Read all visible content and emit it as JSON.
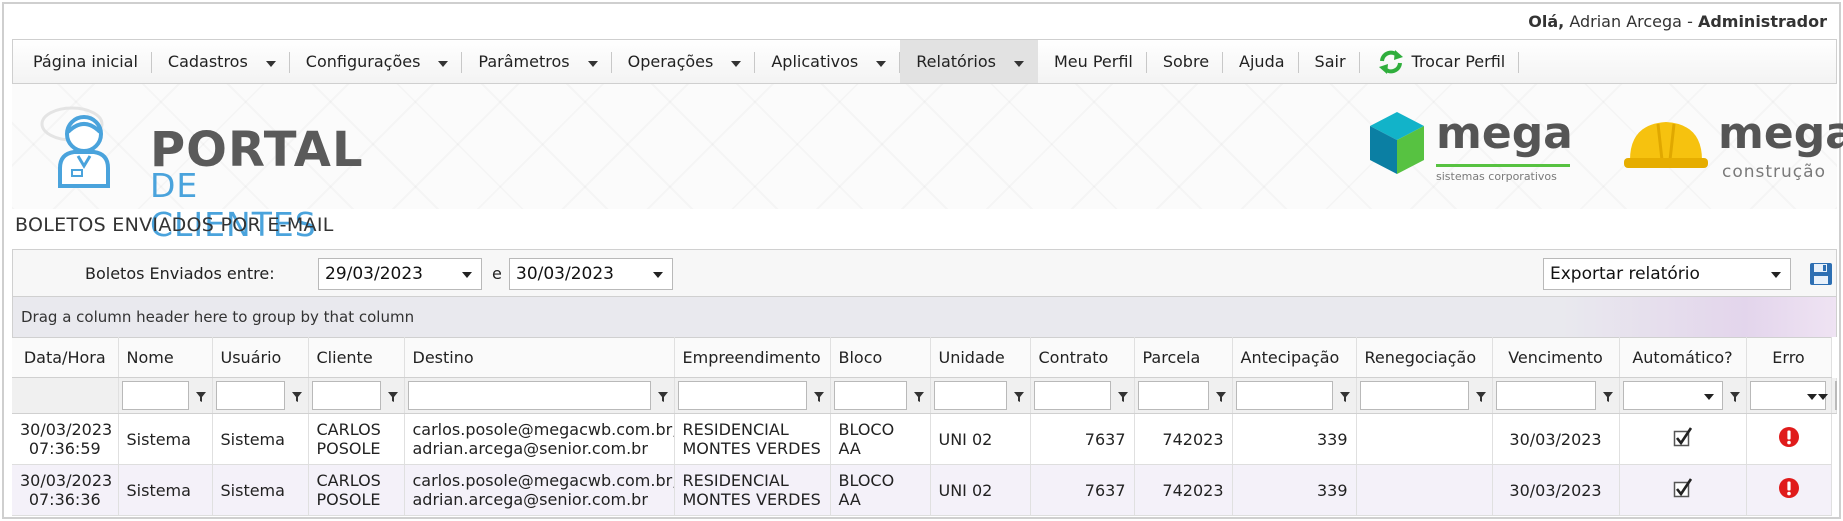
{
  "header": {
    "greeting_prefix": "Olá,",
    "user_name": "Adrian Arcega",
    "separator": "-",
    "role": "Administrador"
  },
  "menu": {
    "items": [
      {
        "label": "Página inicial",
        "dropdown": false
      },
      {
        "label": "Cadastros",
        "dropdown": true
      },
      {
        "label": "Configurações",
        "dropdown": true
      },
      {
        "label": "Parâmetros",
        "dropdown": true
      },
      {
        "label": "Operações",
        "dropdown": true
      },
      {
        "label": "Aplicativos",
        "dropdown": true
      },
      {
        "label": "Relatórios",
        "dropdown": true,
        "active": true
      },
      {
        "label": "Meu Perfil",
        "dropdown": false
      },
      {
        "label": "Sobre",
        "dropdown": false
      },
      {
        "label": "Ajuda",
        "dropdown": false
      },
      {
        "label": "Sair",
        "dropdown": false
      }
    ],
    "switch_profile": {
      "label": "Trocar Perfil",
      "icon": "refresh-icon"
    }
  },
  "banner": {
    "portal_title": "PORTAL",
    "portal_subtitle": "DE CLIENTES",
    "mega1_name": "mega",
    "mega1_sub": "sistemas corporativos",
    "mega2_name": "mega",
    "mega2_sub": "construção"
  },
  "page": {
    "title": "BOLETOS ENVIADOS POR E-MAIL"
  },
  "filters": {
    "range_label": "Boletos Enviados entre:",
    "date_from": "29/03/2023",
    "conjunction": "e",
    "date_to": "30/03/2023",
    "export_select": "Exportar relatório",
    "save_icon": "save-icon"
  },
  "grid": {
    "group_hint": "Drag a column header here to group by that column",
    "columns": {
      "datahora": "Data/Hora",
      "nome": "Nome",
      "usuario": "Usuário",
      "cliente": "Cliente",
      "destino": "Destino",
      "empreendimento": "Empreendimento",
      "bloco": "Bloco",
      "unidade": "Unidade",
      "contrato": "Contrato",
      "parcela": "Parcela",
      "antecipacao": "Antecipação",
      "renegociacao": "Renegociação",
      "vencimento": "Vencimento",
      "automatico": "Automático?",
      "erro": "Erro"
    },
    "rows": [
      {
        "date": "30/03/2023",
        "time": "07:36:59",
        "nome": "Sistema",
        "usuario": "Sistema",
        "cliente1": "CARLOS",
        "cliente2": "POSOLE",
        "destino1": "carlos.posole@megacwb.com.br,",
        "destino2": "adrian.arcega@senior.com.br",
        "emp1": "RESIDENCIAL",
        "emp2": "MONTES VERDES",
        "bloco": "BLOCO AA",
        "unidade": "UNI 02",
        "contrato": "7637",
        "parcela": "742023",
        "antecipacao": "339",
        "renegociacao": "",
        "vencimento": "30/03/2023",
        "automatico": true,
        "erro": "error-icon"
      },
      {
        "date": "30/03/2023",
        "time": "07:36:36",
        "nome": "Sistema",
        "usuario": "Sistema",
        "cliente1": "CARLOS",
        "cliente2": "POSOLE",
        "destino1": "carlos.posole@megacwb.com.br,",
        "destino2": "adrian.arcega@senior.com.br",
        "emp1": "RESIDENCIAL",
        "emp2": "MONTES VERDES",
        "bloco": "BLOCO AA",
        "unidade": "UNI 02",
        "contrato": "7637",
        "parcela": "742023",
        "antecipacao": "339",
        "renegociacao": "",
        "vencimento": "30/03/2023",
        "automatico": true,
        "erro": "error-icon"
      }
    ]
  },
  "colors": {
    "accent_blue": "#4aa3dc",
    "error_red": "#e01b1b",
    "refresh_green": "#2fae3c"
  }
}
